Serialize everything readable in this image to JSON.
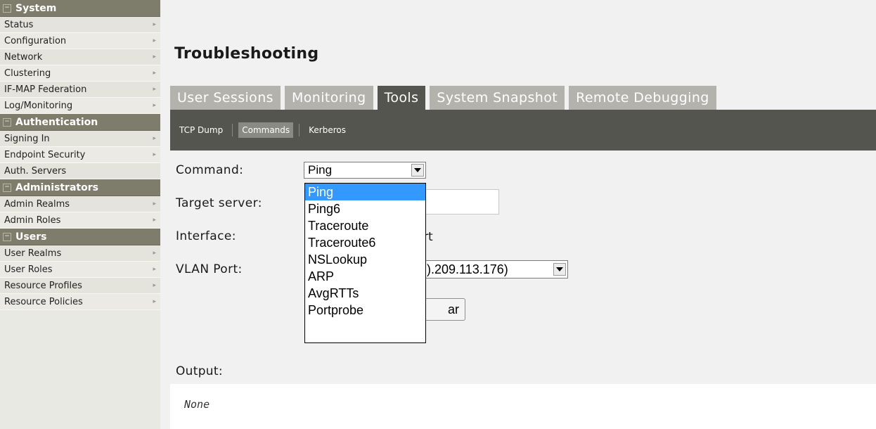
{
  "sidebar": {
    "sections": [
      {
        "title": "System",
        "items": [
          "Status",
          "Configuration",
          "Network",
          "Clustering",
          "IF-MAP Federation",
          "Log/Monitoring"
        ]
      },
      {
        "title": "Authentication",
        "items": [
          "Signing In",
          "Endpoint Security",
          "Auth. Servers"
        ]
      },
      {
        "title": "Administrators",
        "items": [
          "Admin Realms",
          "Admin Roles"
        ]
      },
      {
        "title": "Users",
        "items": [
          "User Realms",
          "User Roles",
          "Resource Profiles",
          "Resource Policies"
        ]
      }
    ]
  },
  "page": {
    "title": "Troubleshooting"
  },
  "tabs": [
    "User Sessions",
    "Monitoring",
    "Tools",
    "System Snapshot",
    "Remote Debugging"
  ],
  "subtabs": [
    "TCP Dump",
    "Commands",
    "Kerberos"
  ],
  "form": {
    "command_label": "Command:",
    "command_value": "Ping",
    "target_label": "Target server:",
    "target_value": "",
    "interface_label": "Interface:",
    "interface_value_visible": "rt",
    "vlan_label": "VLAN Port:",
    "vlan_value_visible": ").209.113.176)",
    "clear_button_visible": "ar"
  },
  "dropdown_options": [
    "Ping",
    "Ping6",
    "Traceroute",
    "Traceroute6",
    "NSLookup",
    "ARP",
    "AvgRTTs",
    "Portprobe"
  ],
  "output": {
    "label": "Output:",
    "text": "None"
  }
}
